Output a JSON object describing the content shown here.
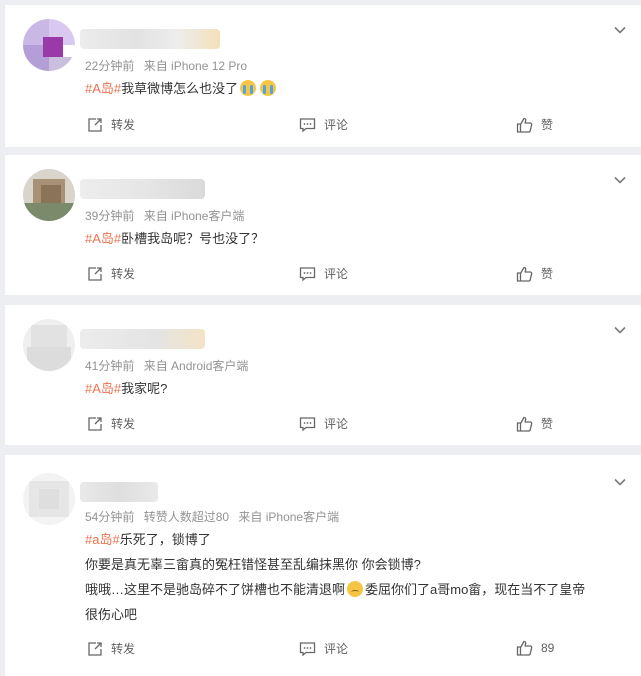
{
  "comments": [
    {
      "time": "22分钟前",
      "source": "来自 iPhone 12 Pro",
      "lines": [
        {
          "tag": "#A岛#",
          "text": "我草微博怎么也没了",
          "emojis": [
            "cry-icon",
            "cry-icon"
          ]
        }
      ],
      "actions": {
        "repost": "转发",
        "comment": "评论",
        "like": "赞"
      }
    },
    {
      "time": "39分钟前",
      "source": "来自 iPhone客户端",
      "lines": [
        {
          "tag": "#A岛#",
          "text": "卧槽我岛呢？号也没了？"
        }
      ],
      "actions": {
        "repost": "转发",
        "comment": "评论",
        "like": "赞"
      }
    },
    {
      "time": "41分钟前",
      "source": "来自 Android客户端",
      "lines": [
        {
          "tag": "#A岛#",
          "text": "我家呢?"
        }
      ],
      "actions": {
        "repost": "转发",
        "comment": "评论",
        "like": "赞"
      }
    },
    {
      "time": "54分钟前",
      "extra": "转赞人数超过80",
      "source": "来自 iPhone客户端",
      "lines": [
        {
          "tag": "#a岛#",
          "text": "乐死了，锁博了"
        },
        {
          "text": "你要是真无辜三畲真的冤枉错怪甚至乱编抹黑你 你会锁博?"
        },
        {
          "text": "哦哦…这里不是驰岛碎不了饼槽也不能清退啊",
          "emojis": [
            "sad-icon"
          ],
          "text_after": "委屈你们了a哥mo畲，现在当不了皇帝"
        },
        {
          "text": "很伤心吧"
        }
      ],
      "actions": {
        "repost": "转发",
        "comment": "评论",
        "like": "89"
      }
    }
  ],
  "colors": {
    "tag": "#eb7350",
    "meta": "#939393",
    "text": "#333333",
    "background": "#eceef1"
  }
}
